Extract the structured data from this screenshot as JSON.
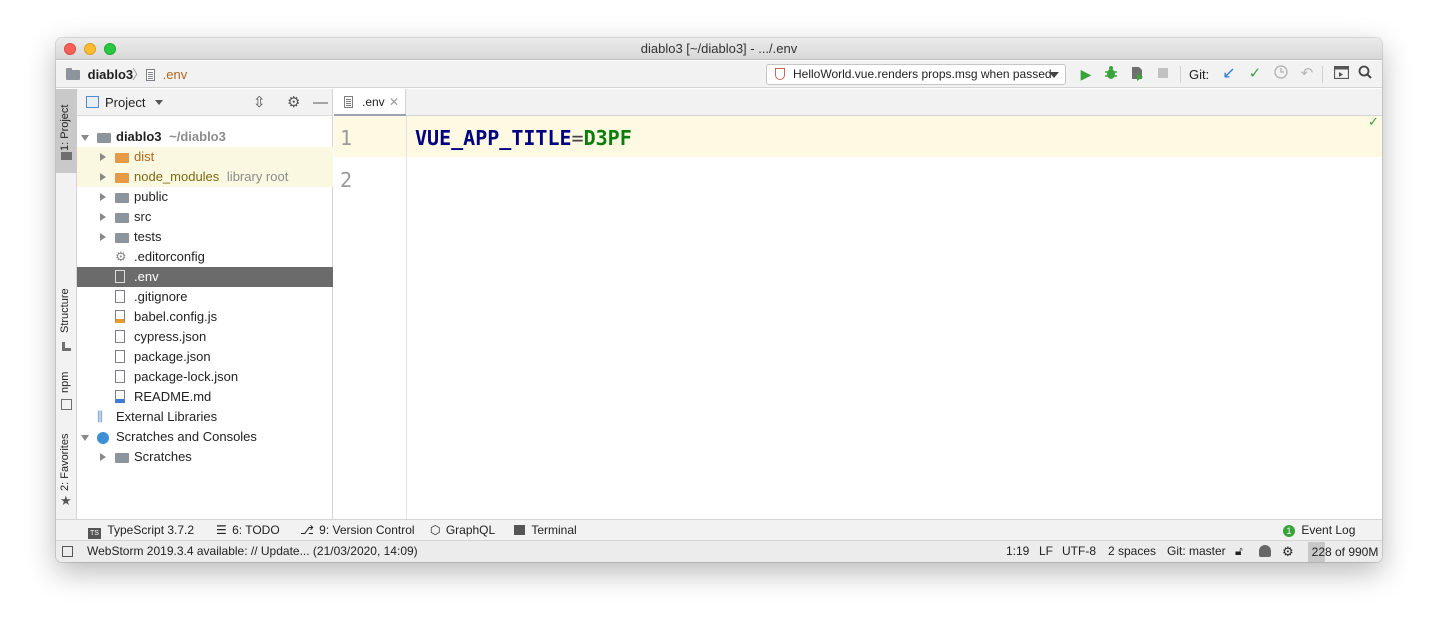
{
  "window": {
    "title": "diablo3 [~/diablo3] - .../.env"
  },
  "navbar": {
    "crumbs": [
      "diablo3",
      ".env"
    ],
    "run_config": "HelloWorld.vue.renders props.msg when passed",
    "git_label": "Git:"
  },
  "tool_strip": {
    "tabs": [
      "1: Project",
      "Structure",
      "npm",
      "2: Favorites"
    ]
  },
  "project_panel": {
    "title": "Project",
    "tree": [
      {
        "label": "diablo3",
        "hint": "~/diablo3",
        "icon": "folder-icon",
        "expanded": true,
        "depth": 0,
        "bold": true
      },
      {
        "label": "dist",
        "hint": "",
        "icon": "folder-orange-icon",
        "expanded": false,
        "depth": 1
      },
      {
        "label": "node_modules",
        "hint": "library root",
        "icon": "folder-orange-icon",
        "expanded": false,
        "depth": 1
      },
      {
        "label": "public",
        "hint": "",
        "icon": "folder-icon",
        "expanded": false,
        "depth": 1
      },
      {
        "label": "src",
        "hint": "",
        "icon": "folder-icon",
        "expanded": false,
        "depth": 1
      },
      {
        "label": "tests",
        "hint": "",
        "icon": "folder-icon",
        "expanded": false,
        "depth": 1
      },
      {
        "label": ".editorconfig",
        "hint": "",
        "icon": "gear-icon",
        "depth": 1
      },
      {
        "label": ".env",
        "hint": "",
        "icon": "text-file-icon",
        "depth": 1,
        "selected": true
      },
      {
        "label": ".gitignore",
        "hint": "",
        "icon": "ignore-file-icon",
        "depth": 1
      },
      {
        "label": "babel.config.js",
        "hint": "",
        "icon": "js-file-icon",
        "depth": 1
      },
      {
        "label": "cypress.json",
        "hint": "",
        "icon": "json-file-icon",
        "depth": 1
      },
      {
        "label": "package.json",
        "hint": "",
        "icon": "json-file-icon",
        "depth": 1
      },
      {
        "label": "package-lock.json",
        "hint": "",
        "icon": "json-file-icon",
        "depth": 1
      },
      {
        "label": "README.md",
        "hint": "",
        "icon": "markdown-file-icon",
        "depth": 1
      },
      {
        "label": "External Libraries",
        "hint": "",
        "icon": "library-icon",
        "depth": 0
      },
      {
        "label": "Scratches and Consoles",
        "hint": "",
        "icon": "scratches-icon",
        "expanded": true,
        "depth": 0
      },
      {
        "label": "Scratches",
        "hint": "",
        "icon": "folder-icon",
        "expanded": false,
        "depth": 1
      }
    ]
  },
  "editor": {
    "tab_label": ".env",
    "line_numbers": [
      "1",
      "2"
    ],
    "line1": {
      "key": "VUE_APP_TITLE",
      "eq": "=",
      "value": "D3PF"
    }
  },
  "bottom_tools": [
    {
      "label": "TypeScript 3.7.2",
      "icon": "typescript-icon"
    },
    {
      "label": "6: TODO",
      "icon": "todo-list-icon"
    },
    {
      "label": "9: Version Control",
      "icon": "vcs-icon"
    },
    {
      "label": "GraphQL",
      "icon": "graphql-icon"
    },
    {
      "label": "Terminal",
      "icon": "terminal-icon"
    }
  ],
  "event_log": {
    "label": "Event Log",
    "badge": "1"
  },
  "status": {
    "message": "WebStorm 2019.3.4 available: // Update... (21/03/2020, 14:09)",
    "position": "1:19",
    "line_sep": "LF",
    "encoding": "UTF-8",
    "indent": "2 spaces",
    "branch": "Git: master",
    "memory": "228 of 990M",
    "memory_used_fraction": 0.23
  },
  "colors": {
    "key": "#000080",
    "value": "#0a7d0a",
    "selection": "#6b6b6b",
    "accent_blue": "#2f7bd6",
    "run_green": "#3ba33b"
  }
}
